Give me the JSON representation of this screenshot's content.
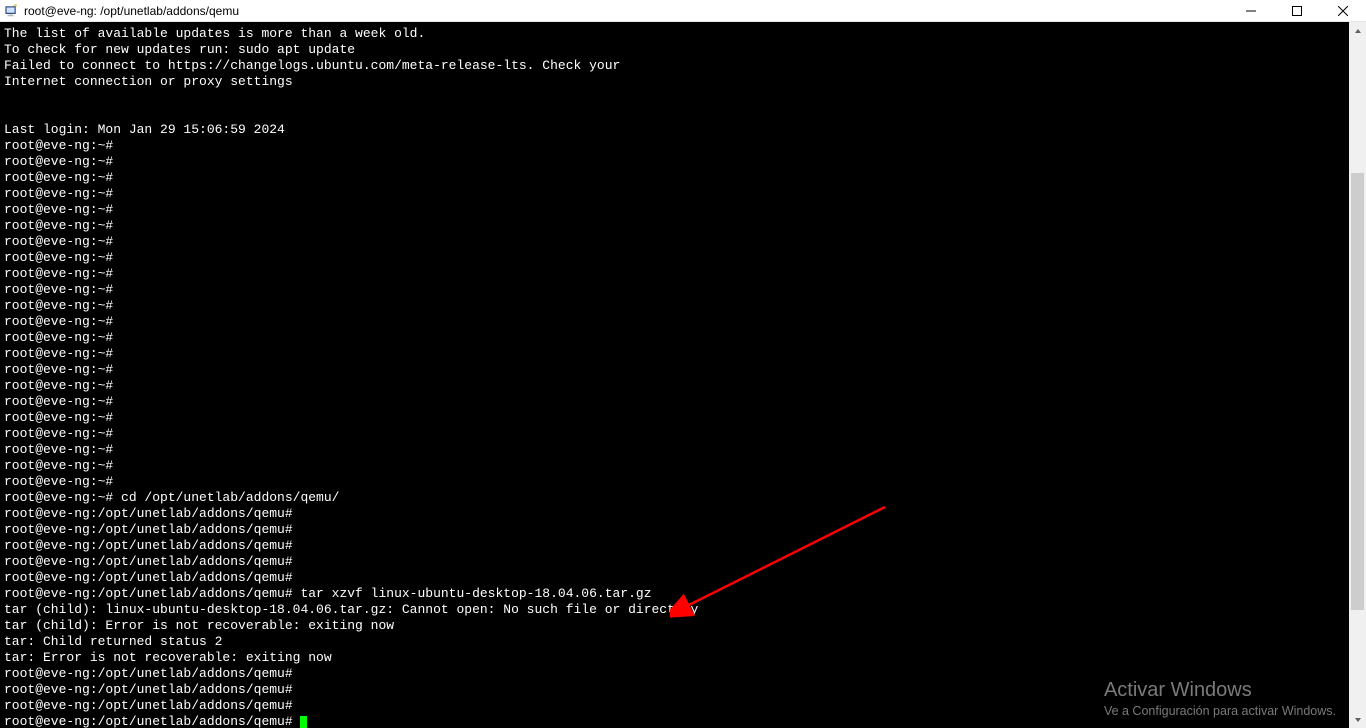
{
  "window": {
    "title": "root@eve-ng: /opt/unetlab/addons/qemu"
  },
  "terminal": {
    "lines": [
      "The list of available updates is more than a week old.",
      "To check for new updates run: sudo apt update",
      "Failed to connect to https://changelogs.ubuntu.com/meta-release-lts. Check your",
      "Internet connection or proxy settings",
      "",
      "",
      "Last login: Mon Jan 29 15:06:59 2024",
      "root@eve-ng:~#",
      "root@eve-ng:~#",
      "root@eve-ng:~#",
      "root@eve-ng:~#",
      "root@eve-ng:~#",
      "root@eve-ng:~#",
      "root@eve-ng:~#",
      "root@eve-ng:~#",
      "root@eve-ng:~#",
      "root@eve-ng:~#",
      "root@eve-ng:~#",
      "root@eve-ng:~#",
      "root@eve-ng:~#",
      "root@eve-ng:~#",
      "root@eve-ng:~#",
      "root@eve-ng:~#",
      "root@eve-ng:~#",
      "root@eve-ng:~#",
      "root@eve-ng:~#",
      "root@eve-ng:~#",
      "root@eve-ng:~#",
      "root@eve-ng:~#",
      "root@eve-ng:~# cd /opt/unetlab/addons/qemu/",
      "root@eve-ng:/opt/unetlab/addons/qemu#",
      "root@eve-ng:/opt/unetlab/addons/qemu#",
      "root@eve-ng:/opt/unetlab/addons/qemu#",
      "root@eve-ng:/opt/unetlab/addons/qemu#",
      "root@eve-ng:/opt/unetlab/addons/qemu#",
      "root@eve-ng:/opt/unetlab/addons/qemu# tar xzvf linux-ubuntu-desktop-18.04.06.tar.gz",
      "tar (child): linux-ubuntu-desktop-18.04.06.tar.gz: Cannot open: No such file or directory",
      "tar (child): Error is not recoverable: exiting now",
      "tar: Child returned status 2",
      "tar: Error is not recoverable: exiting now",
      "root@eve-ng:/opt/unetlab/addons/qemu#",
      "root@eve-ng:/opt/unetlab/addons/qemu#",
      "root@eve-ng:/opt/unetlab/addons/qemu#"
    ],
    "active_prompt": "root@eve-ng:/opt/unetlab/addons/qemu# "
  },
  "watermark": {
    "title": "Activar Windows",
    "subtitle": "Ve a Configuración para activar Windows."
  },
  "annotation": {
    "arrow_color": "#ff0000"
  }
}
